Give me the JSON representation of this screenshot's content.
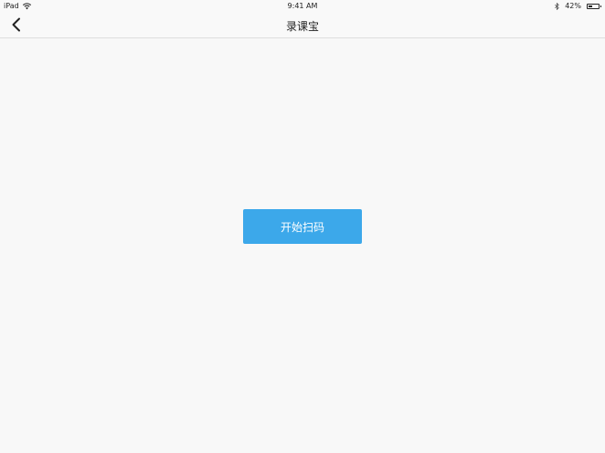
{
  "status_bar": {
    "device": "iPad",
    "time": "9:41 AM",
    "battery_text": "42%",
    "battery_level": 0.42,
    "icons": [
      "wifi-icon",
      "bluetooth-icon",
      "battery-icon"
    ]
  },
  "nav": {
    "back_icon": "chevron-left-icon",
    "title": "录课宝"
  },
  "main": {
    "start_scan_label": "开始扫码"
  },
  "colors": {
    "accent": "#3ca8ea",
    "background": "#f8f8f8"
  }
}
